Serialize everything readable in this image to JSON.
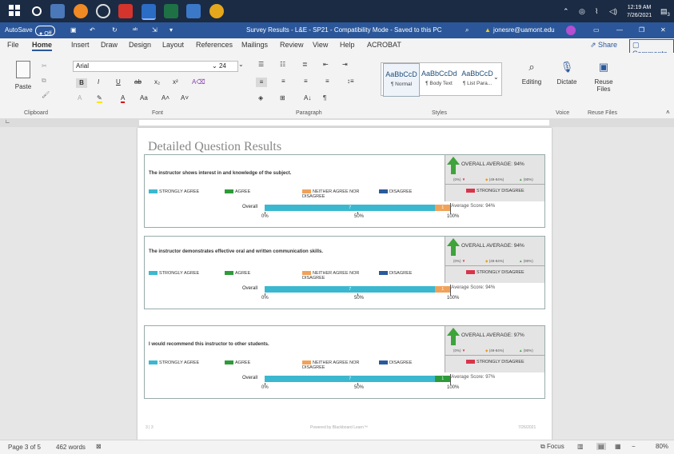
{
  "taskbar": {
    "time": "12:19 AM",
    "date": "7/26/2021",
    "notification_count": "3"
  },
  "title_bar": {
    "autosave_label": "AutoSave",
    "autosave_state": "Off",
    "doc_title": "Survey Results - L&E - SP21  -  Compatibility Mode  -  Saved to this PC",
    "account": "jonesre@uamont.edu"
  },
  "menu": {
    "items": [
      "File",
      "Home",
      "Insert",
      "Draw",
      "Design",
      "Layout",
      "References",
      "Mailings",
      "Review",
      "View",
      "Help",
      "ACROBAT"
    ],
    "share_label": "Share",
    "comments_label": "Comments"
  },
  "ribbon": {
    "paste_label": "Paste",
    "font_name": "Arial",
    "font_size": "24",
    "styles": [
      {
        "preview": "AaBbCcD",
        "name": "¶ Normal"
      },
      {
        "preview": "AaBbCcDd",
        "name": "¶ Body Text"
      },
      {
        "preview": "AaBbCcD",
        "name": "¶ List Para..."
      }
    ],
    "editing_label": "Editing",
    "dictate_label": "Dictate",
    "reuse_label": "Reuse Files",
    "groups": [
      "Clipboard",
      "Font",
      "Paragraph",
      "Styles",
      "Voice",
      "Reuse Files"
    ]
  },
  "page": {
    "heading": "Detailed Question Results",
    "footer_left": "3  |  3",
    "footer_center": "Powered by Blackboard Learn™",
    "footer_right": "7/26/2021"
  },
  "legend": {
    "strongly_agree": "STRONGLY AGREE",
    "agree": "AGREE",
    "neither": "NEITHER AGREE NOR DISAGREE",
    "disagree": "DISAGREE",
    "strongly_disagree": "STRONGLY DISAGREE",
    "overall": "Overall",
    "scale_low": "(0%)",
    "scale_mid": "(49-84%)",
    "scale_high": "(90%)"
  },
  "ticks": [
    "0%",
    "50%",
    "100%"
  ],
  "questions": [
    {
      "text": "The instructor shows interest in and knowledge of the subject.",
      "overall": "OVERALL AVERAGE: 94%",
      "score": "Average Score: 94%",
      "sa": 0.92,
      "ag": 0.0,
      "ne": 0.08,
      "sa_n": "7",
      "ag_n": "",
      "ne_n": "1"
    },
    {
      "text": "The instructor demonstrates effective oral and written communication skills.",
      "overall": "OVERALL AVERAGE: 94%",
      "score": "Average Score: 94%",
      "sa": 0.92,
      "ag": 0.0,
      "ne": 0.08,
      "sa_n": "7",
      "ag_n": "",
      "ne_n": "1"
    },
    {
      "text": "I would recommend this instructor to other students.",
      "overall": "OVERALL AVERAGE: 97%",
      "score": "Average Score: 97%",
      "sa": 0.92,
      "ag": 0.08,
      "ne": 0.0,
      "sa_n": "7",
      "ag_n": "1",
      "ne_n": ""
    }
  ],
  "status": {
    "page": "Page 3 of 5",
    "words": "462 words",
    "focus": "Focus",
    "zoom": "80%"
  },
  "colors": {
    "strongly_agree": "#3bb8cf",
    "agree": "#2e9b3a",
    "neither": "#f0a25a",
    "disagree": "#2a5a9b",
    "strongly_disagree": "#d9344a",
    "word_blue": "#2b579a"
  }
}
